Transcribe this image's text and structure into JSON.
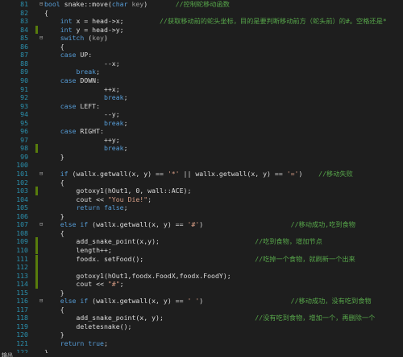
{
  "editor": {
    "colors": {
      "background": "#1e1e1e",
      "line_number": "#2b91af",
      "keyword": "#569cd6",
      "string": "#d69d85",
      "comment": "#57a64a",
      "plain": "#dcdcdc",
      "parameter": "#9a9a9a",
      "change_marker": "#587c0c"
    },
    "lines": [
      {
        "num": "81",
        "fold": "⊟",
        "changed": false,
        "tokens": [
          [
            "kw",
            "bool"
          ],
          [
            "pl",
            " snake::"
          ],
          [
            "pl",
            "move"
          ],
          [
            "pl",
            "("
          ],
          [
            "kw",
            "char"
          ],
          [
            "pr",
            " key"
          ],
          [
            "pl",
            ")"
          ],
          [
            "pl",
            "       "
          ],
          [
            "cm",
            "//控制蛇移动函数"
          ]
        ]
      },
      {
        "num": "82",
        "fold": "",
        "changed": false,
        "tokens": [
          [
            "pl",
            "{"
          ]
        ]
      },
      {
        "num": "83",
        "fold": "",
        "changed": false,
        "tokens": [
          [
            "pl",
            "    "
          ],
          [
            "kw",
            "int"
          ],
          [
            "pl",
            " x = head->x;"
          ],
          [
            "pl",
            "         "
          ],
          [
            "cm",
            "//获取移动前的蛇头坐标，目的是要判断移动前方（蛇头前）的#。空格还是*"
          ]
        ]
      },
      {
        "num": "84",
        "fold": "",
        "changed": true,
        "tokens": [
          [
            "pl",
            "    "
          ],
          [
            "kw",
            "int"
          ],
          [
            "pl",
            " y = head->y;"
          ]
        ]
      },
      {
        "num": "85",
        "fold": "⊟",
        "changed": false,
        "tokens": [
          [
            "pl",
            "    "
          ],
          [
            "kw",
            "switch"
          ],
          [
            "pl",
            " ("
          ],
          [
            "pr",
            "key"
          ],
          [
            "pl",
            ")"
          ]
        ]
      },
      {
        "num": "86",
        "fold": "",
        "changed": false,
        "tokens": [
          [
            "pl",
            "    {"
          ]
        ]
      },
      {
        "num": "87",
        "fold": "",
        "changed": false,
        "tokens": [
          [
            "pl",
            "    "
          ],
          [
            "kw",
            "case"
          ],
          [
            "pl",
            " UP:"
          ]
        ]
      },
      {
        "num": "88",
        "fold": "",
        "changed": false,
        "tokens": [
          [
            "pl",
            "               --x;"
          ]
        ]
      },
      {
        "num": "89",
        "fold": "",
        "changed": false,
        "tokens": [
          [
            "pl",
            "        "
          ],
          [
            "kw",
            "break"
          ],
          [
            "pl",
            ";"
          ]
        ]
      },
      {
        "num": "90",
        "fold": "",
        "changed": false,
        "tokens": [
          [
            "pl",
            "    "
          ],
          [
            "kw",
            "case"
          ],
          [
            "pl",
            " DOWN:"
          ]
        ]
      },
      {
        "num": "91",
        "fold": "",
        "changed": false,
        "tokens": [
          [
            "pl",
            "               ++x;"
          ]
        ]
      },
      {
        "num": "92",
        "fold": "",
        "changed": false,
        "tokens": [
          [
            "pl",
            "               "
          ],
          [
            "kw",
            "break"
          ],
          [
            "pl",
            ";"
          ]
        ]
      },
      {
        "num": "93",
        "fold": "",
        "changed": false,
        "tokens": [
          [
            "pl",
            "    "
          ],
          [
            "kw",
            "case"
          ],
          [
            "pl",
            " LEFT:"
          ]
        ]
      },
      {
        "num": "94",
        "fold": "",
        "changed": false,
        "tokens": [
          [
            "pl",
            "               --y;"
          ]
        ]
      },
      {
        "num": "95",
        "fold": "",
        "changed": false,
        "tokens": [
          [
            "pl",
            "               "
          ],
          [
            "kw",
            "break"
          ],
          [
            "pl",
            ";"
          ]
        ]
      },
      {
        "num": "96",
        "fold": "",
        "changed": false,
        "tokens": [
          [
            "pl",
            "    "
          ],
          [
            "kw",
            "case"
          ],
          [
            "pl",
            " RIGHT:"
          ]
        ]
      },
      {
        "num": "97",
        "fold": "",
        "changed": false,
        "tokens": [
          [
            "pl",
            "               ++y;"
          ]
        ]
      },
      {
        "num": "98",
        "fold": "",
        "changed": true,
        "tokens": [
          [
            "pl",
            "               "
          ],
          [
            "kw",
            "break"
          ],
          [
            "pl",
            ";"
          ]
        ]
      },
      {
        "num": "99",
        "fold": "",
        "changed": false,
        "tokens": [
          [
            "pl",
            "    }"
          ]
        ]
      },
      {
        "num": "100",
        "fold": "",
        "changed": false,
        "tokens": [
          [
            "pl",
            ""
          ]
        ]
      },
      {
        "num": "101",
        "fold": "⊟",
        "changed": false,
        "tokens": [
          [
            "pl",
            "    "
          ],
          [
            "kw",
            "if"
          ],
          [
            "pl",
            " (wallx.getwall(x, y) == "
          ],
          [
            "st",
            "'*'"
          ],
          [
            "pl",
            " || wallx.getwall(x, y) == "
          ],
          [
            "st",
            "'='"
          ],
          [
            "pl",
            ")"
          ],
          [
            "pl",
            "    "
          ],
          [
            "cm",
            "//移动失败"
          ]
        ]
      },
      {
        "num": "102",
        "fold": "",
        "changed": false,
        "tokens": [
          [
            "pl",
            "    {"
          ]
        ]
      },
      {
        "num": "103",
        "fold": "",
        "changed": true,
        "tokens": [
          [
            "pl",
            "        gotoxy1(hOut1, 0, "
          ],
          [
            "pl",
            "wall::ACE"
          ],
          [
            "pl",
            ");"
          ]
        ]
      },
      {
        "num": "104",
        "fold": "",
        "changed": false,
        "tokens": [
          [
            "pl",
            "        cout << "
          ],
          [
            "st",
            "\"You Die!\""
          ],
          [
            "pl",
            ";"
          ]
        ]
      },
      {
        "num": "105",
        "fold": "",
        "changed": false,
        "tokens": [
          [
            "pl",
            "        "
          ],
          [
            "kw",
            "return"
          ],
          [
            "pl",
            " "
          ],
          [
            "kw",
            "false"
          ],
          [
            "pl",
            ";"
          ]
        ]
      },
      {
        "num": "106",
        "fold": "",
        "changed": false,
        "tokens": [
          [
            "pl",
            "    }"
          ]
        ]
      },
      {
        "num": "107",
        "fold": "⊟",
        "changed": false,
        "tokens": [
          [
            "pl",
            "    "
          ],
          [
            "kw",
            "else if"
          ],
          [
            "pl",
            " (wallx.getwall(x, y) == "
          ],
          [
            "st",
            "'#'"
          ],
          [
            "pl",
            ")"
          ],
          [
            "pl",
            "                      "
          ],
          [
            "cm",
            "//移动成功,吃到食物"
          ]
        ]
      },
      {
        "num": "108",
        "fold": "",
        "changed": false,
        "tokens": [
          [
            "pl",
            "    {"
          ]
        ]
      },
      {
        "num": "109",
        "fold": "",
        "changed": true,
        "tokens": [
          [
            "pl",
            "        add_snake_point(x,y);"
          ],
          [
            "pl",
            "                        "
          ],
          [
            "cm",
            "//吃到食物，增加节点"
          ]
        ]
      },
      {
        "num": "110",
        "fold": "",
        "changed": true,
        "tokens": [
          [
            "pl",
            "        length++;"
          ]
        ]
      },
      {
        "num": "111",
        "fold": "",
        "changed": true,
        "tokens": [
          [
            "pl",
            "        foodx. setFood();"
          ],
          [
            "pl",
            "                            "
          ],
          [
            "cm",
            "//吃掉一个食物，就刷新一个出来"
          ]
        ]
      },
      {
        "num": "112",
        "fold": "",
        "changed": true,
        "tokens": [
          [
            "pl",
            ""
          ]
        ]
      },
      {
        "num": "113",
        "fold": "",
        "changed": true,
        "tokens": [
          [
            "pl",
            "        gotoxy1(hOut1,foodx.FoodX,foodx.FoodY);"
          ]
        ]
      },
      {
        "num": "114",
        "fold": "",
        "changed": true,
        "tokens": [
          [
            "pl",
            "        cout << "
          ],
          [
            "st",
            "\"#\""
          ],
          [
            "pl",
            ";"
          ]
        ]
      },
      {
        "num": "115",
        "fold": "",
        "changed": false,
        "tokens": [
          [
            "pl",
            "    }"
          ]
        ]
      },
      {
        "num": "116",
        "fold": "⊟",
        "changed": false,
        "tokens": [
          [
            "pl",
            "    "
          ],
          [
            "kw",
            "else if"
          ],
          [
            "pl",
            " (wallx.getwall(x, y) == "
          ],
          [
            "st",
            "' '"
          ],
          [
            "pl",
            ")"
          ],
          [
            "pl",
            "                      "
          ],
          [
            "cm",
            "//移动成功，没有吃到食物"
          ]
        ]
      },
      {
        "num": "117",
        "fold": "",
        "changed": false,
        "tokens": [
          [
            "pl",
            "    {"
          ]
        ]
      },
      {
        "num": "118",
        "fold": "",
        "changed": false,
        "tokens": [
          [
            "pl",
            "        add_snake_point(x, y);"
          ],
          [
            "pl",
            "                       "
          ],
          [
            "cm",
            "//没有吃到食物，增加一个，再删除一个"
          ]
        ]
      },
      {
        "num": "119",
        "fold": "",
        "changed": false,
        "tokens": [
          [
            "pl",
            "        deletesnake();"
          ]
        ]
      },
      {
        "num": "120",
        "fold": "",
        "changed": false,
        "tokens": [
          [
            "pl",
            "    }"
          ]
        ]
      },
      {
        "num": "121",
        "fold": "",
        "changed": false,
        "tokens": [
          [
            "pl",
            "    "
          ],
          [
            "kw",
            "return"
          ],
          [
            "pl",
            " "
          ],
          [
            "kw",
            "true"
          ],
          [
            "pl",
            ";"
          ]
        ]
      },
      {
        "num": "122",
        "fold": "",
        "changed": false,
        "tokens": [
          [
            "pl",
            "}"
          ]
        ]
      }
    ]
  },
  "statusbar": {
    "text": "输出"
  }
}
